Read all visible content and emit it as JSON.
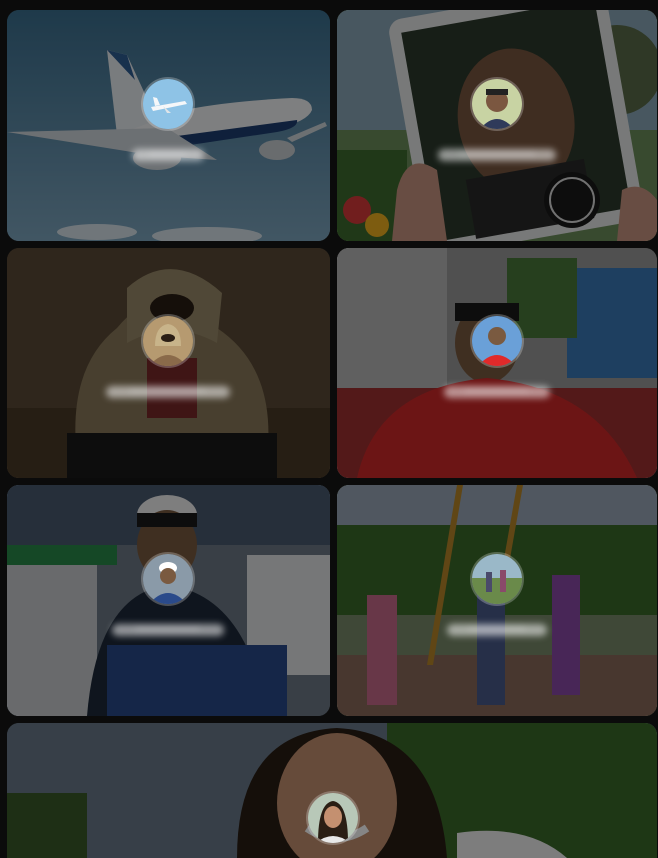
{
  "tiles": [
    {
      "id": "t1",
      "subject": "airplane",
      "label": "••••••",
      "avatar_icon": "airplane-avatar"
    },
    {
      "id": "t2",
      "subject": "tablet-photo",
      "label": "••••••••••••",
      "avatar_icon": "person-avatar"
    },
    {
      "id": "t3",
      "subject": "hooded-person",
      "label": "••••••••••••",
      "avatar_icon": "person-avatar"
    },
    {
      "id": "t4",
      "subject": "red-shirt-man",
      "label": "••••••••••",
      "avatar_icon": "person-avatar"
    },
    {
      "id": "t5",
      "subject": "helmet-man",
      "label": "••••••••••",
      "avatar_icon": "person-avatar"
    },
    {
      "id": "t6",
      "subject": "park-people",
      "label": "•••••••••",
      "avatar_icon": "person-avatar"
    },
    {
      "id": "t7",
      "subject": "smiling-woman",
      "label": "",
      "avatar_icon": "person-avatar"
    }
  ],
  "colors": {
    "dim_overlay": "#000000",
    "label_blur": "#ffffff",
    "tile_bg": "#111111"
  }
}
